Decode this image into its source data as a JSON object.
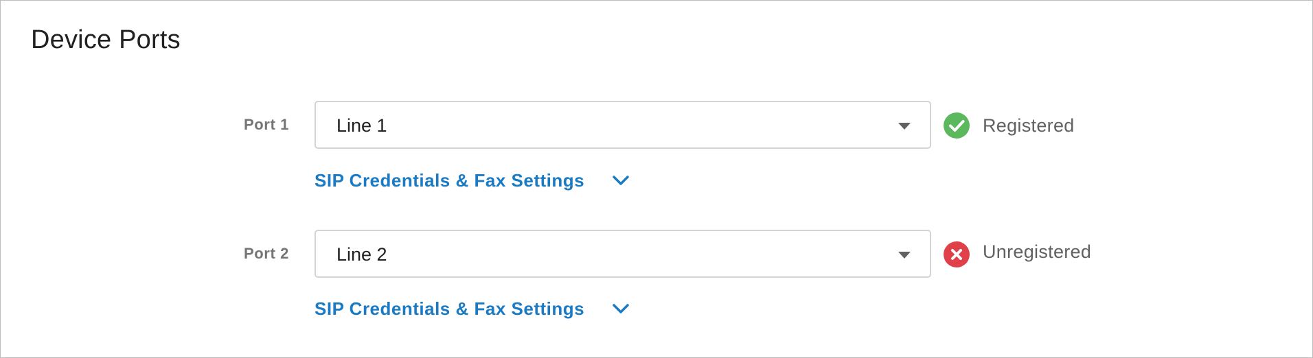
{
  "section": {
    "title": "Device Ports"
  },
  "ports": [
    {
      "label": "Port 1",
      "line": "Line 1",
      "status": "Registered",
      "status_color": "#5cb85c",
      "status_icon": "check-circle-icon",
      "settings_link": "SIP Credentials & Fax Settings"
    },
    {
      "label": "Port 2",
      "line": "Line 2",
      "status": "Unregistered",
      "status_color": "#e0404a",
      "status_icon": "error-circle-icon",
      "settings_link": "SIP Credentials & Fax Settings"
    }
  ],
  "colors": {
    "link": "#1a7bc4",
    "label": "#757575",
    "border": "#d3d3d3"
  }
}
